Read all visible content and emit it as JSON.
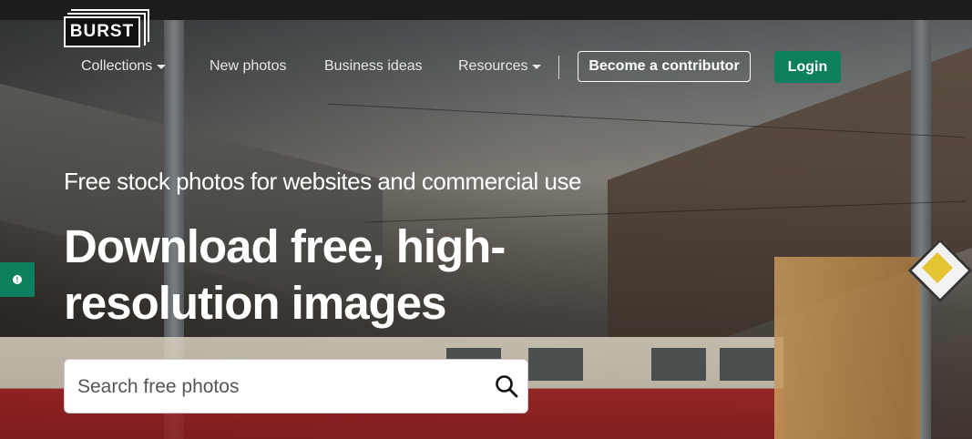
{
  "brand": {
    "logo_text": "BURST"
  },
  "nav": {
    "items": [
      {
        "label": "Collections",
        "has_dropdown": true
      },
      {
        "label": "New photos",
        "has_dropdown": false
      },
      {
        "label": "Business ideas",
        "has_dropdown": false
      },
      {
        "label": "Resources",
        "has_dropdown": true
      }
    ],
    "contributor_label": "Become a contributor",
    "login_label": "Login"
  },
  "hero": {
    "subtitle": "Free stock photos for websites and commercial use",
    "headline": "Download free, high-resolution images"
  },
  "search": {
    "placeholder": "Search free photos"
  },
  "colors": {
    "accent": "#0c7f5e",
    "topbar": "#1c1c1c",
    "text": "#ffffff"
  },
  "icons": {
    "search": "search-icon",
    "feedback": "feedback-icon"
  }
}
